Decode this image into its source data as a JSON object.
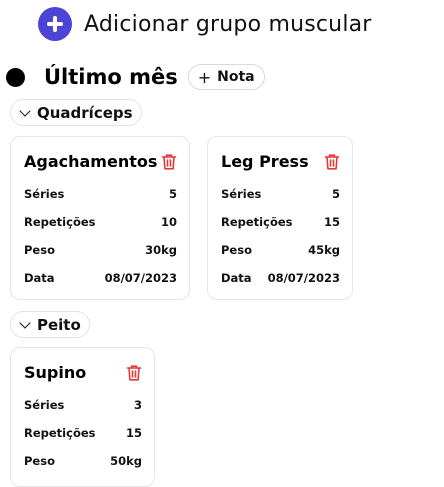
{
  "header": {
    "add_group_label": "Adicionar grupo muscular"
  },
  "month": {
    "title": "Último mês",
    "note_label": "Nota"
  },
  "groups": [
    {
      "name": "Quadríceps",
      "exercises": [
        {
          "name": "Agachamentos",
          "rows": [
            {
              "label": "Séries",
              "value": "5"
            },
            {
              "label": "Repetições",
              "value": "10"
            },
            {
              "label": "Peso",
              "value": "30kg"
            },
            {
              "label": "Data",
              "value": "08/07/2023"
            }
          ]
        },
        {
          "name": "Leg Press",
          "rows": [
            {
              "label": "Séries",
              "value": "5"
            },
            {
              "label": "Repetições",
              "value": "15"
            },
            {
              "label": "Peso",
              "value": "45kg"
            },
            {
              "label": "Data",
              "value": "08/07/2023"
            }
          ]
        }
      ]
    },
    {
      "name": "Peito",
      "exercises": [
        {
          "name": "Supino",
          "rows": [
            {
              "label": "Séries",
              "value": "3"
            },
            {
              "label": "Repetições",
              "value": "15"
            },
            {
              "label": "Peso",
              "value": "50kg"
            }
          ]
        }
      ]
    }
  ],
  "colors": {
    "accent": "#4b44d6",
    "delete": "#e53935"
  },
  "icons": {
    "add": "plus-circle-icon",
    "delete": "trash-icon",
    "collapse": "chevron-down-icon"
  }
}
